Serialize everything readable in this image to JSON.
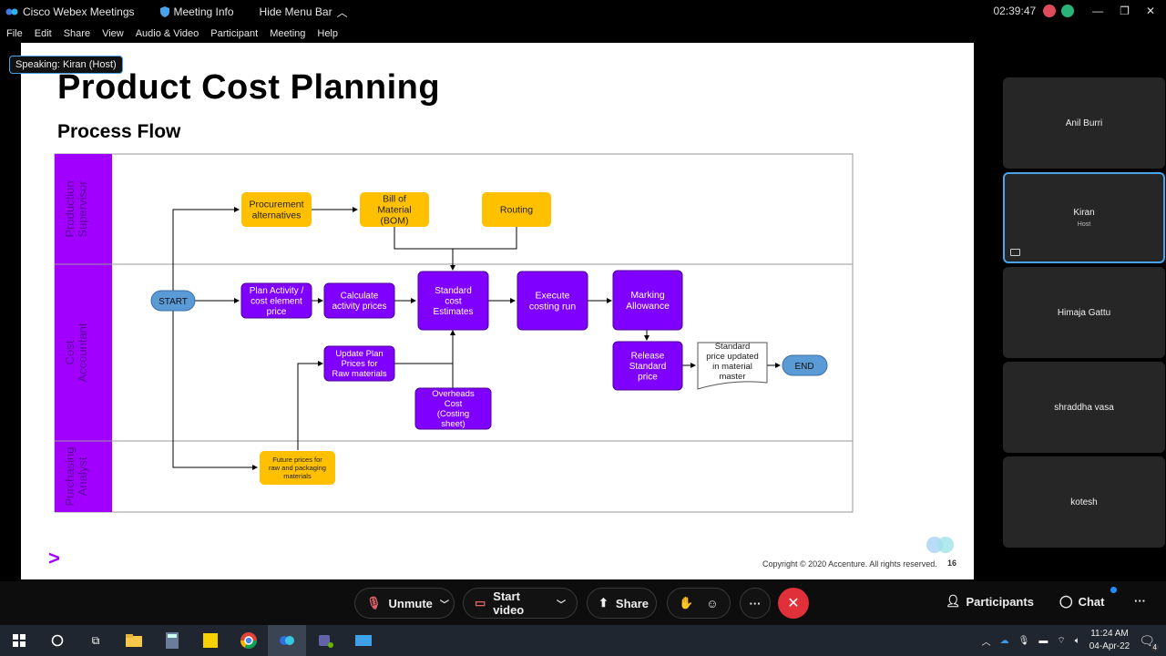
{
  "titlebar": {
    "app_name": "Cisco Webex Meetings",
    "meeting_info": "Meeting Info",
    "hide_menu": "Hide Menu Bar",
    "timer": "02:39:47"
  },
  "menu": [
    "File",
    "Edit",
    "Share",
    "View",
    "Audio & Video",
    "Participant",
    "Meeting",
    "Help"
  ],
  "speaking": "Speaking: Kiran (Host)",
  "slide": {
    "title": "Product Cost Planning",
    "subtitle": "Process Flow",
    "copyright": "Copyright © 2020 Accenture. All rights reserved.",
    "page": "16",
    "logo": ">"
  },
  "diagram": {
    "lanes": [
      "Production Supervisor",
      "Cost Accountant",
      "Purchasing Analyst"
    ],
    "nodes": {
      "start": "START",
      "procurement": [
        "Procurement",
        "alternatives"
      ],
      "bom": [
        "Bill of",
        "Material",
        "(BOM)"
      ],
      "routing": [
        "Routing"
      ],
      "plan_activity": [
        "Plan Activity /",
        "cost element",
        "price"
      ],
      "calc_activity": [
        "Calculate",
        "activity prices"
      ],
      "std_cost": [
        "Standard",
        "cost",
        "Estimates"
      ],
      "execute": [
        "Execute",
        "costing run"
      ],
      "marking": [
        "Marking",
        "Allowance"
      ],
      "release": [
        "Release",
        "Standard",
        "price"
      ],
      "std_updated": [
        "Standard",
        "price updated",
        "in material",
        "master"
      ],
      "end": "END",
      "update_plan": [
        "Update Plan",
        "Prices for",
        "Raw materials"
      ],
      "overheads": [
        "Overheads",
        "Cost",
        "(Costing",
        "sheet)"
      ],
      "future_prices": [
        "Future prices for",
        "raw and packaging",
        "materials"
      ]
    },
    "colors": {
      "lane": "#a100ff",
      "yellow": "#ffc000",
      "purple": "#8000ff",
      "blue": "#5b9bd5"
    }
  },
  "participants": [
    {
      "name": "Anil Burri",
      "role": ""
    },
    {
      "name": "Kiran",
      "role": "Host"
    },
    {
      "name": "Himaja Gattu",
      "role": ""
    },
    {
      "name": "shraddha vasa",
      "role": ""
    },
    {
      "name": "kotesh",
      "role": ""
    }
  ],
  "controls": {
    "unmute": "Unmute",
    "start_video": "Start video",
    "share": "Share",
    "more": "···",
    "participants": "Participants",
    "chat": "Chat"
  },
  "taskbar": {
    "time": "11:24 AM",
    "date": "04-Apr-22",
    "notifications": "4"
  }
}
